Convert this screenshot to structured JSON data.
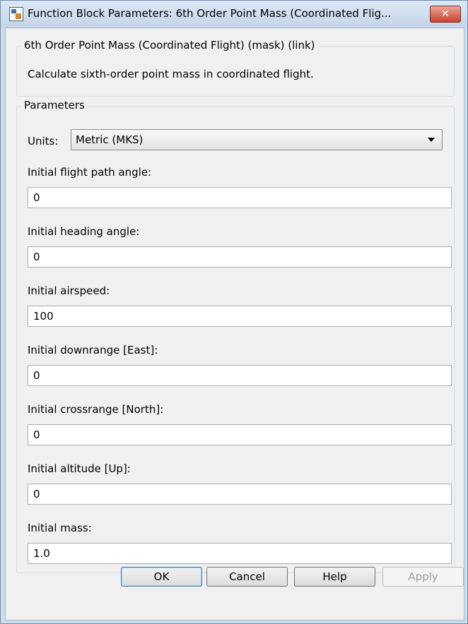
{
  "window": {
    "title": "Function Block Parameters: 6th Order Point Mass (Coordinated Flig...",
    "close_glyph": "✕"
  },
  "description": {
    "group_title": "6th Order Point Mass (Coordinated Flight) (mask) (link)",
    "text": "Calculate sixth-order point mass in coordinated flight."
  },
  "parameters": {
    "group_title": "Parameters",
    "units_label": "Units:",
    "units_value": "Metric (MKS)",
    "fields": [
      {
        "label": "Initial flight path angle:",
        "value": "0"
      },
      {
        "label": "Initial heading angle:",
        "value": "0"
      },
      {
        "label": "Initial airspeed:",
        "value": "100"
      },
      {
        "label": "Initial downrange [East]:",
        "value": "0"
      },
      {
        "label": "Initial crossrange [North]:",
        "value": "0"
      },
      {
        "label": "Initial altitude [Up]:",
        "value": "0"
      },
      {
        "label": "Initial mass:",
        "value": "1.0"
      }
    ]
  },
  "buttons": {
    "ok": "OK",
    "cancel": "Cancel",
    "help": "Help",
    "apply": "Apply"
  },
  "icons": {
    "app": "simulink-block-icon",
    "close": "close-icon",
    "dropdown": "chevron-down-icon"
  }
}
